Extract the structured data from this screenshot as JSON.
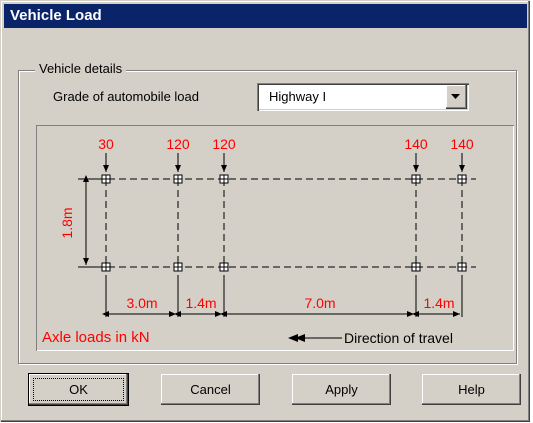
{
  "window": {
    "title": "Vehicle Load"
  },
  "group": {
    "label": "Vehicle details"
  },
  "grade": {
    "label": "Grade of automobile load",
    "value": "Highway I",
    "dropdown_icon": "chevron-down-icon"
  },
  "diagram": {
    "axle_loads": [
      "30",
      "120",
      "120",
      "140",
      "140"
    ],
    "width_label": "1.8m",
    "spacings": [
      "3.0m",
      "1.4m",
      "7.0m",
      "1.4m"
    ],
    "axle_loads_caption": "Axle loads in kN",
    "direction_caption": "Direction of travel",
    "label_color": "#ff0000"
  },
  "buttons": {
    "ok": "OK",
    "cancel": "Cancel",
    "apply": "Apply",
    "help": "Help"
  }
}
